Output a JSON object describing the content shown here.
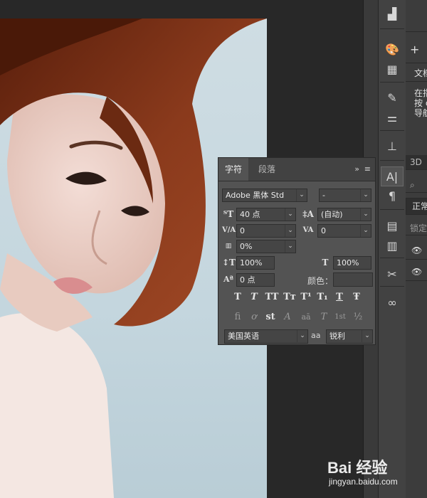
{
  "char_panel": {
    "tabs": [
      "字符",
      "段落"
    ],
    "menu_icons": [
      "double-chevron-right-icon",
      "hamburger-menu-icon"
    ],
    "font_family": "Adobe 黑体 Std",
    "font_style": "-",
    "font_size": "40 点",
    "leading": "(自动)",
    "kerning": "0",
    "tracking": "0",
    "scale_tsume": "0%",
    "vertical_scale": "100%",
    "horizontal_scale": "100%",
    "baseline_shift": "0 点",
    "color_label": "颜色：",
    "format_buttons": [
      "T",
      "T",
      "TT",
      "Tт",
      "T¹",
      "T₁",
      "T",
      "Ŧ"
    ],
    "opentype_buttons": [
      "fi",
      "ơ",
      "st",
      "A",
      "aā",
      "T",
      "1st",
      "½"
    ],
    "language": "美国英语",
    "aa_label": "aa",
    "antialias": "锐利"
  },
  "side_panel": {
    "doc_tab": "文档",
    "hint_lines": [
      "在指",
      "按 c",
      "导航"
    ],
    "tab_3d": "3D",
    "blend_mode": "正常",
    "lock_label": "锁定"
  },
  "watermark": {
    "brand": "Bai 经验",
    "url": "jingyan.baidu.com"
  },
  "toolbar_icons": [
    "histogram-icon",
    "palette-icon",
    "grid-icon",
    "brush-presets-icon",
    "adjustments-icon",
    "clone-stamp-icon",
    "character-icon",
    "paragraph-icon",
    "document-icon",
    "notes-icon",
    "tools-icon",
    "creative-cloud-icon"
  ],
  "colors": {
    "panel_bg": "#535353",
    "ui_dark": "#282828",
    "backdrop": "#c8d9e0",
    "hair": "#7a3418"
  }
}
